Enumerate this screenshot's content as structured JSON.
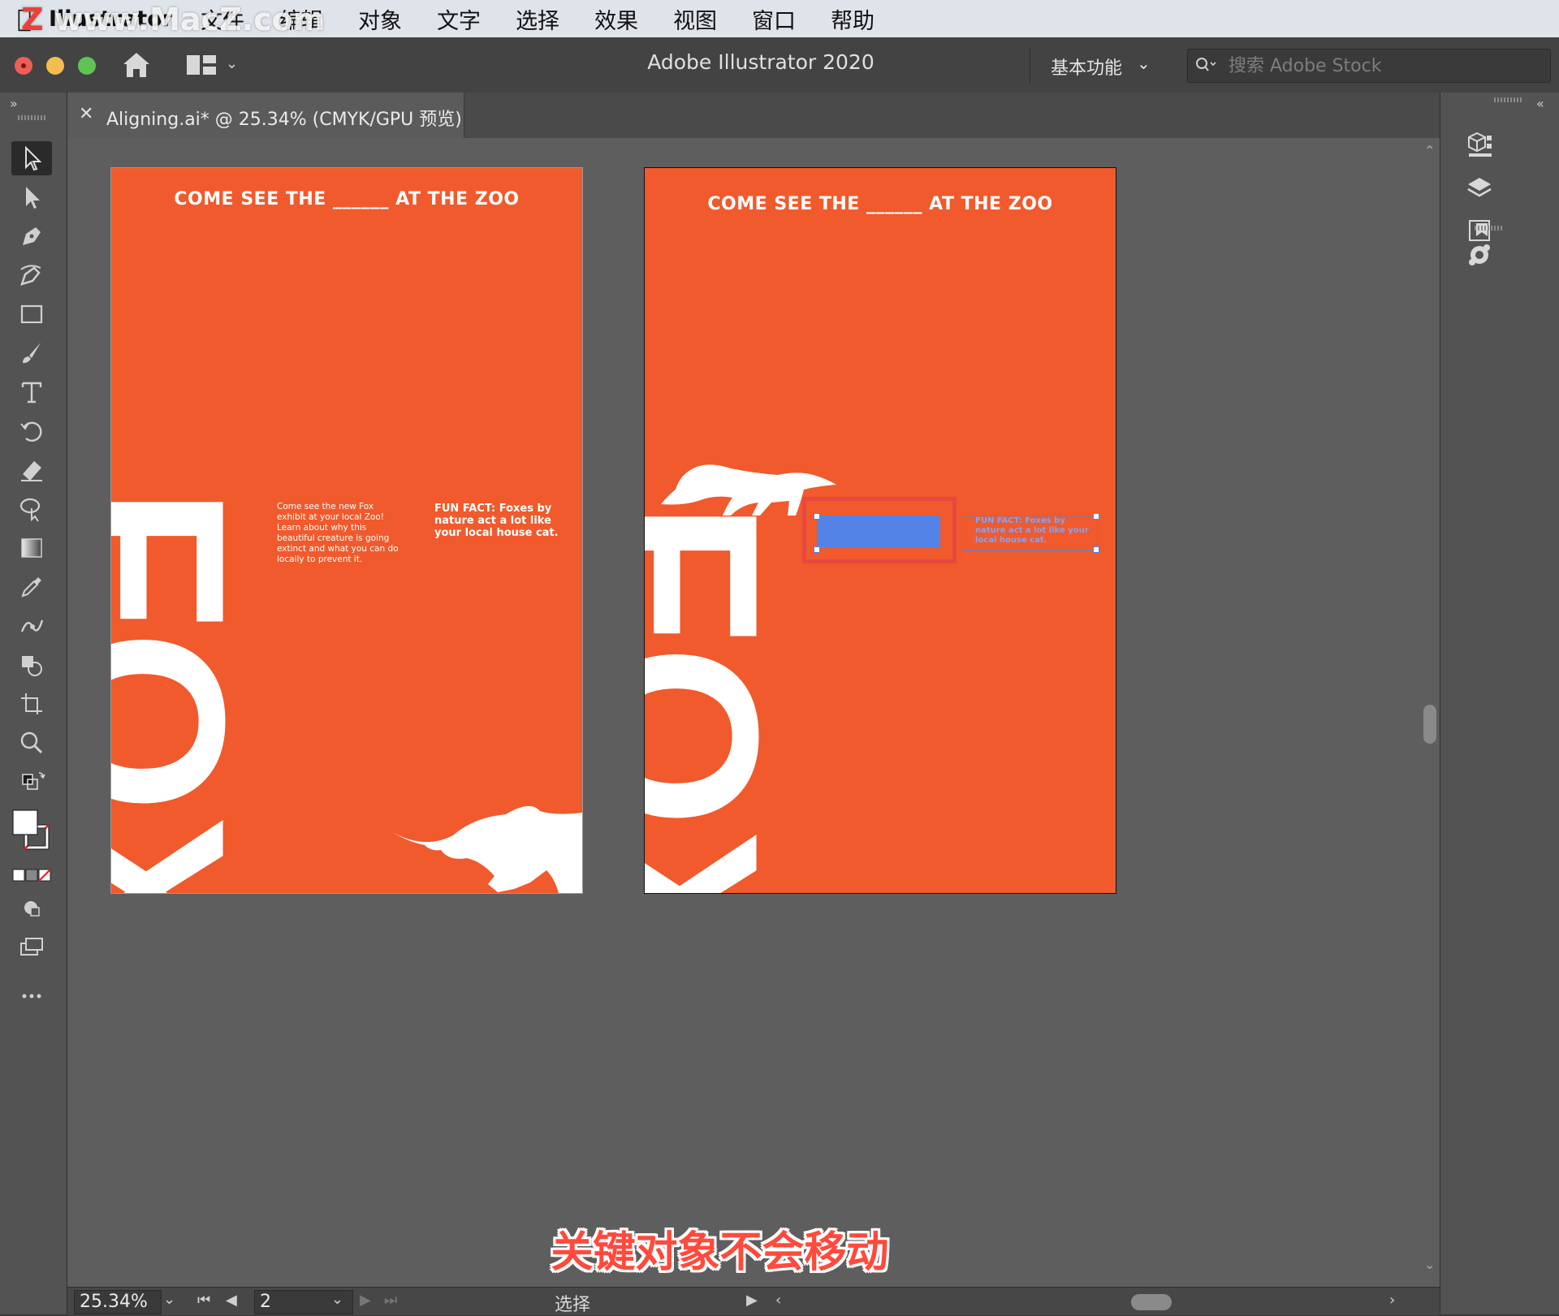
{
  "watermark": {
    "text": "www.MacZ.com"
  },
  "menubar": {
    "app_name": "Illustrator",
    "items": [
      "文件",
      "编辑",
      "对象",
      "文字",
      "选择",
      "效果",
      "视图",
      "窗口",
      "帮助"
    ]
  },
  "titlebar": {
    "title": "Adobe Illustrator 2020",
    "workspace": "基本功能",
    "search_placeholder": "搜索 Adobe Stock"
  },
  "document_tab": {
    "label": "Aligning.ai* @ 25.34% (CMYK/GPU 预览)"
  },
  "artboards": [
    {
      "headline": "COME SEE THE ______ AT THE ZOO",
      "big_word": "FOX",
      "body_copy": "Come see the new Fox exhibit at your local Zoo! Learn about why this beautiful creature is going extinct and what you can do locally to prevent it.",
      "fun_fact": "FUN FACT: Foxes by nature act a lot like your local house cat."
    },
    {
      "headline": "COME SEE THE ______ AT THE ZOO",
      "big_word": "FOX",
      "fun_fact": "FUN FACT: Foxes by nature act a lot like your local house cat."
    }
  ],
  "colors": {
    "artboard_orange": "#f05a2c",
    "selection_blue": "#4a86f0",
    "key_object_outline": "#e8473f",
    "caption": "#ff4a3c"
  },
  "statusbar": {
    "zoom": "25.34%",
    "artboard_number": "2",
    "current_tool": "选择"
  },
  "caption": "关键对象不会移动",
  "icons": {
    "left_tools": [
      "selection-tool-icon",
      "direct-selection-tool-icon",
      "pen-tool-icon",
      "curvature-tool-icon",
      "rectangle-tool-icon",
      "paintbrush-tool-icon",
      "type-tool-icon",
      "rotate-tool-icon",
      "eraser-tool-icon",
      "lasso-tool-icon",
      "gradient-tool-icon",
      "eyedropper-tool-icon",
      "puppet-warp-tool-icon",
      "shape-builder-tool-icon",
      "artboard-tool-icon",
      "zoom-tool-icon"
    ],
    "right_panels": [
      "libraries-icon",
      "layers-icon",
      "artboards-panel-icon",
      "color-themes-icon"
    ]
  }
}
